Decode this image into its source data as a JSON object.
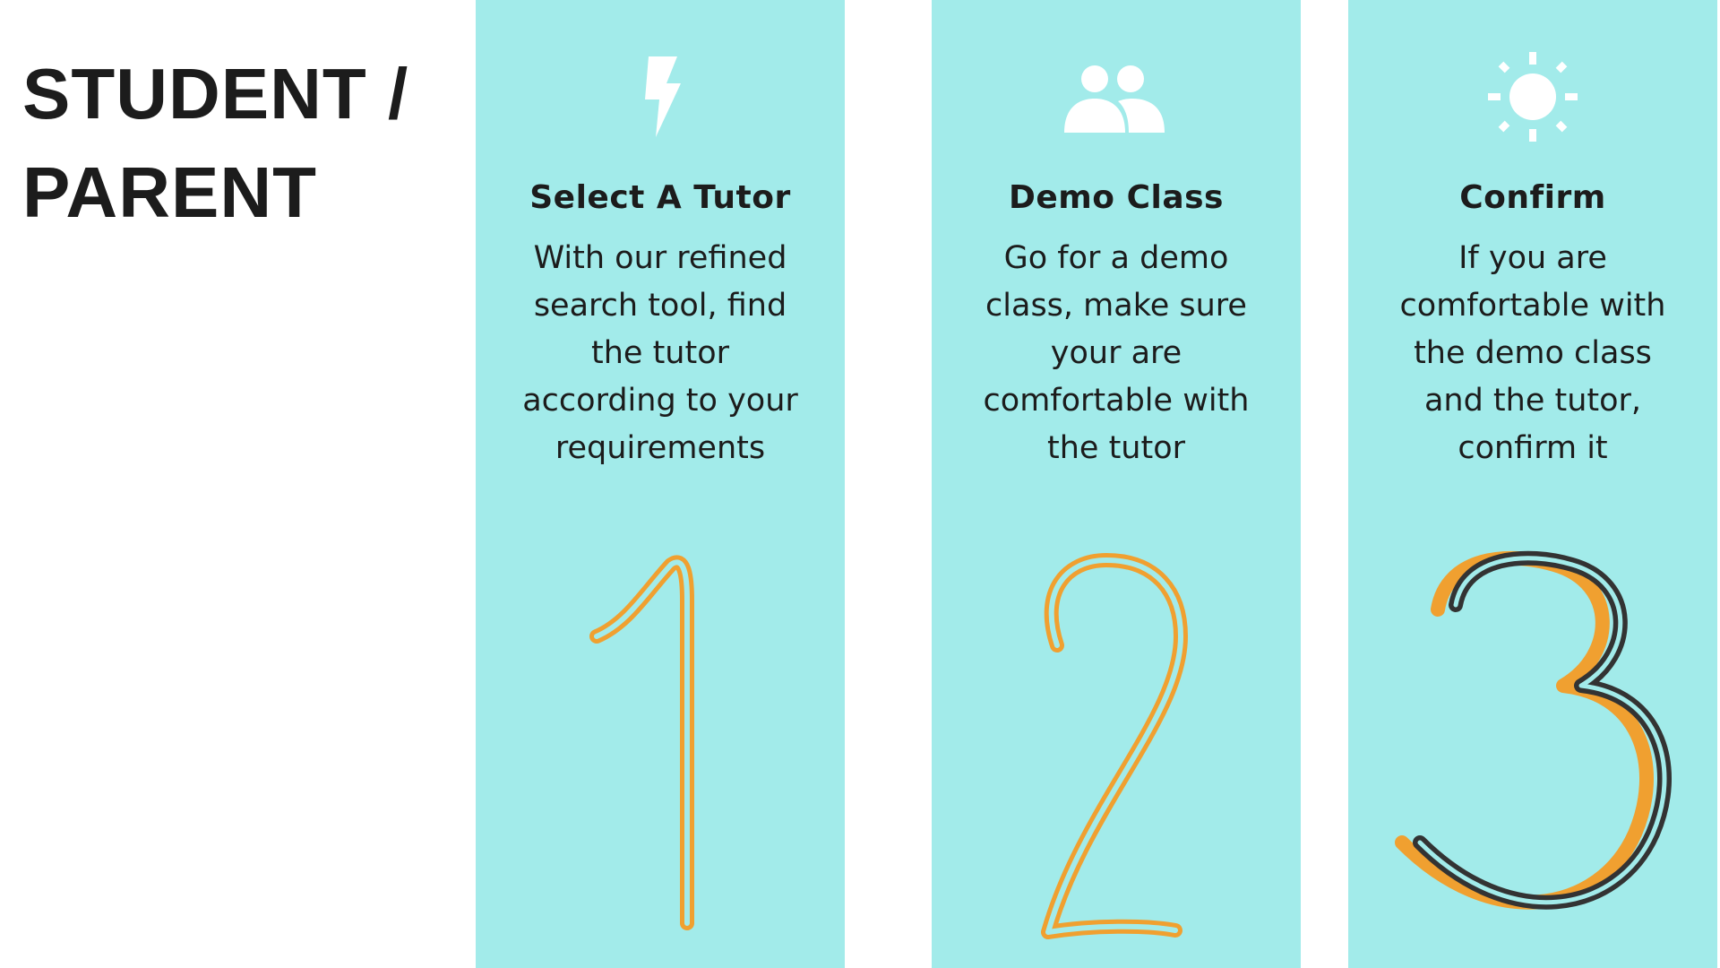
{
  "title": {
    "line1": "STUDENT /",
    "line2": "PARENT"
  },
  "steps": [
    {
      "number": "1",
      "icon": "lightning-icon",
      "title": "Select A Tutor",
      "description": "With our refined search tool, find the tutor according to your requirements"
    },
    {
      "number": "2",
      "icon": "people-icon",
      "title": "Demo Class",
      "description": "Go for a demo class, make sure your are comfortable with the tutor"
    },
    {
      "number": "3",
      "icon": "sun-icon",
      "title": "Confirm",
      "description": "If you are comfortable with the demo class and the tutor, confirm it"
    }
  ],
  "colors": {
    "panel": "#a2ebea",
    "accent": "#f0a030",
    "text": "#1c1c1c",
    "icon": "#ffffff"
  }
}
